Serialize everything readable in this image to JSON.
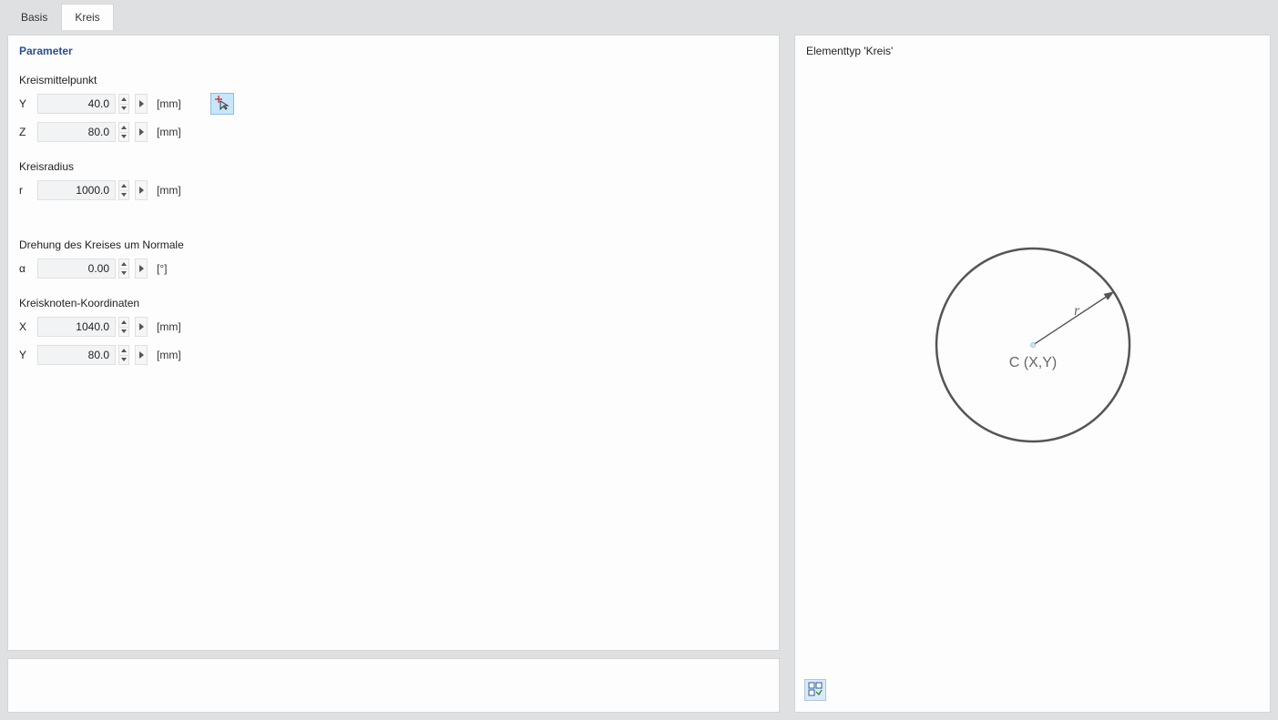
{
  "tabs": {
    "basis": "Basis",
    "kreis": "Kreis"
  },
  "parameters": {
    "title": "Parameter",
    "sections": {
      "center": {
        "label": "Kreismittelpunkt",
        "y": {
          "name": "Y",
          "value": "40.0",
          "unit": "[mm]"
        },
        "z": {
          "name": "Z",
          "value": "80.0",
          "unit": "[mm]"
        }
      },
      "radius": {
        "label": "Kreisradius",
        "r": {
          "name": "r",
          "value": "1000.0",
          "unit": "[mm]"
        }
      },
      "rotation": {
        "label": "Drehung des Kreises um Normale",
        "alpha": {
          "name": "α",
          "value": "0.00",
          "unit": "[°]"
        }
      },
      "node": {
        "label": "Kreisknoten-Koordinaten",
        "x": {
          "name": "X",
          "value": "1040.0",
          "unit": "[mm]"
        },
        "y": {
          "name": "Y",
          "value": "80.0",
          "unit": "[mm]"
        }
      }
    }
  },
  "preview": {
    "title": "Elementtyp 'Kreis'",
    "radius_label": "r",
    "center_label": "C (X,Y)"
  }
}
